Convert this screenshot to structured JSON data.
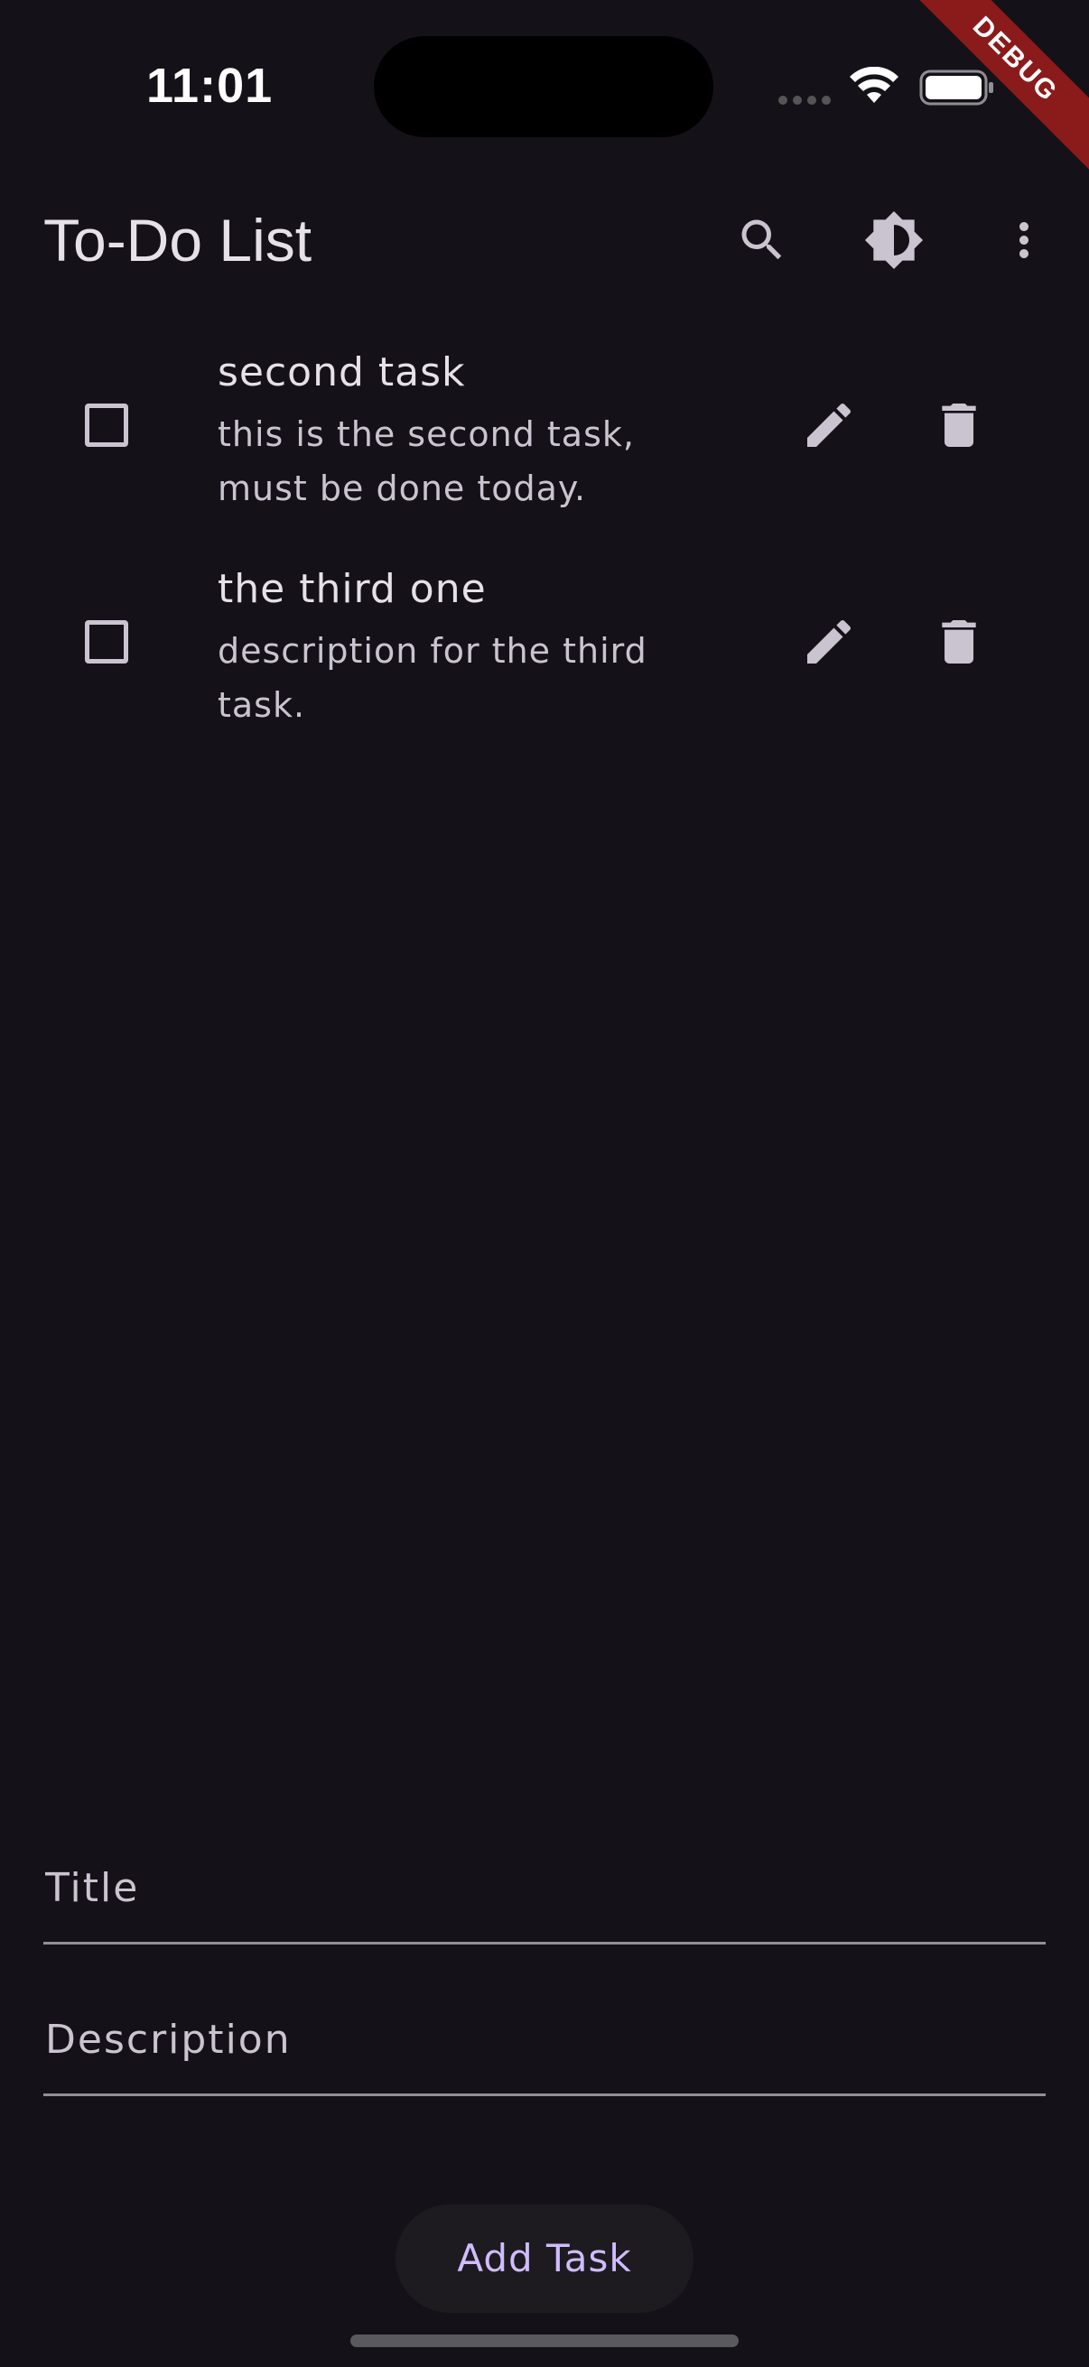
{
  "status_bar": {
    "time": "11:01"
  },
  "debug_banner": "DEBUG",
  "app_bar": {
    "title": "To-Do List",
    "actions": [
      "search-icon",
      "brightness-icon",
      "more-vert-icon"
    ]
  },
  "tasks": [
    {
      "title": "second task",
      "description": "this is the second task, must be done today.",
      "checked": false
    },
    {
      "title": "the third one",
      "description": "description for the third task.",
      "checked": false
    }
  ],
  "form": {
    "title_placeholder": "Title",
    "description_placeholder": "Description",
    "title_value": "",
    "description_value": "",
    "add_button_label": "Add Task"
  },
  "colors": {
    "background": "#141218",
    "accent": "#d0bcff",
    "debug": "#8b1a1a"
  }
}
